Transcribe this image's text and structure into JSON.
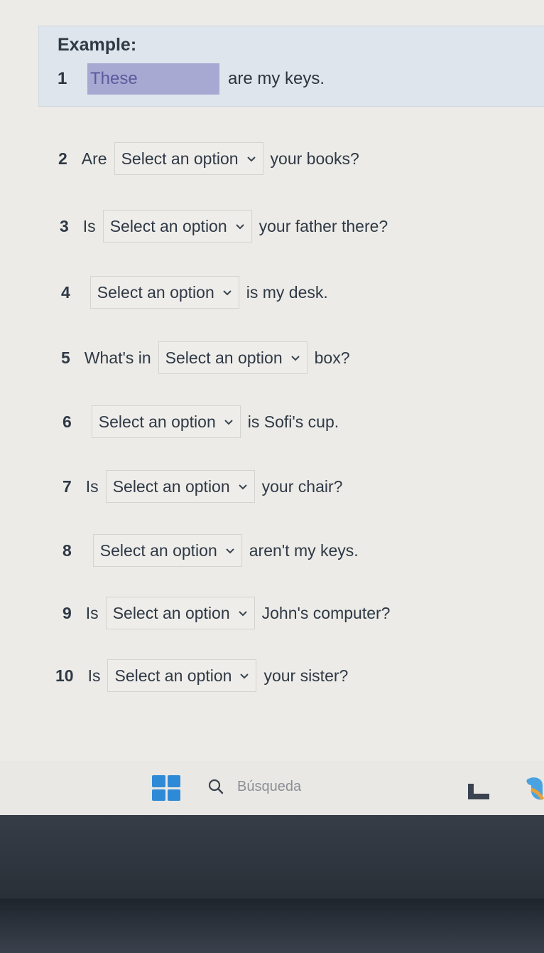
{
  "example": {
    "title": "Example:",
    "number": "1",
    "answer": "These",
    "suffix": "are my keys."
  },
  "select_placeholder": "Select an option",
  "questions": [
    {
      "num": "2",
      "before": "Are",
      "after": "your books?"
    },
    {
      "num": "3",
      "before": "Is",
      "after": "your father there?"
    },
    {
      "num": "4",
      "before": "",
      "after": "is my desk."
    },
    {
      "num": "5",
      "before": "What's in",
      "after": "box?"
    },
    {
      "num": "6",
      "before": "",
      "after": "is Sofi's cup."
    },
    {
      "num": "7",
      "before": "Is",
      "after": "your chair?"
    },
    {
      "num": "8",
      "before": "",
      "after": "aren't my keys."
    },
    {
      "num": "9",
      "before": "Is",
      "after": "John's computer?"
    },
    {
      "num": "10",
      "before": "Is",
      "after": "your sister?"
    }
  ],
  "taskbar": {
    "search_label": "Búsqueda",
    "icons": [
      "windows-start-icon",
      "search-icon",
      "file-explorer-icon",
      "copilot-icon"
    ],
    "start_color": "#2e8ad6"
  },
  "colors": {
    "example_background": "#dfe5ec",
    "answer_highlight": "#a8a9d3"
  }
}
